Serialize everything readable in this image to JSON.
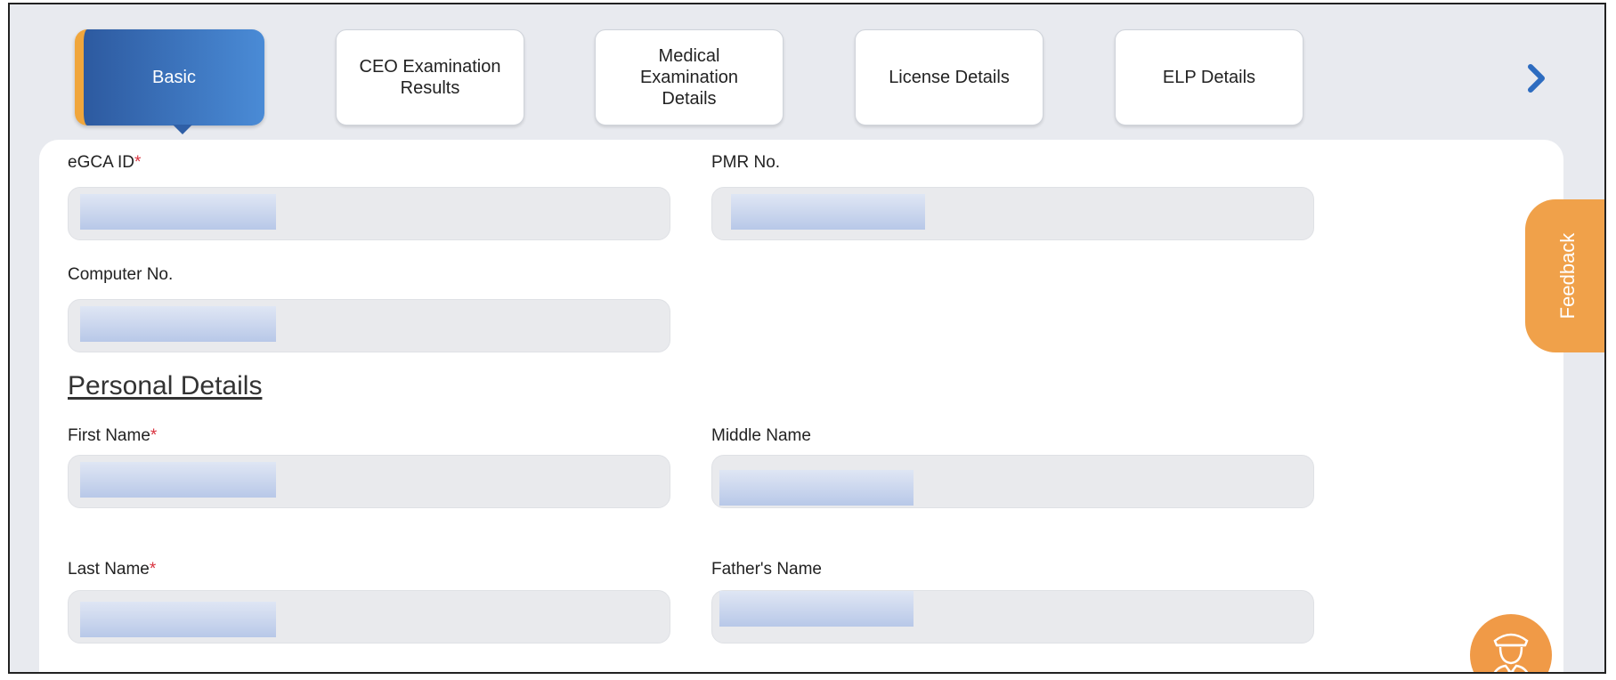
{
  "tabs": [
    {
      "label": "Basic"
    },
    {
      "label": "CEO Examination Results"
    },
    {
      "label": "Medical Examination Details"
    },
    {
      "label": "License Details"
    },
    {
      "label": "ELP Details"
    }
  ],
  "nav_icon": "chevron-right-icon",
  "fields": {
    "egca_id": {
      "label": "eGCA ID",
      "required_mark": "*"
    },
    "pmr_no": {
      "label": "PMR No."
    },
    "computer_no": {
      "label": "Computer No."
    },
    "first_name": {
      "label": "First Name",
      "required_mark": "*"
    },
    "middle_name": {
      "label": "Middle Name"
    },
    "last_name": {
      "label": "Last Name",
      "required_mark": "*"
    },
    "fathers_name": {
      "label": "Father's Name"
    }
  },
  "section": {
    "title": "Personal Details"
  },
  "feedback": {
    "label": "Feedback"
  },
  "avatar_icon": "pilot-avatar-icon",
  "colors": {
    "active_tab_start": "#2d5aa0",
    "active_tab_end": "#4a8bd6",
    "accent_orange": "#f0a14a",
    "required": "#d9333f",
    "field_bg": "#e9eaed",
    "redaction": "#b8c8e8"
  }
}
